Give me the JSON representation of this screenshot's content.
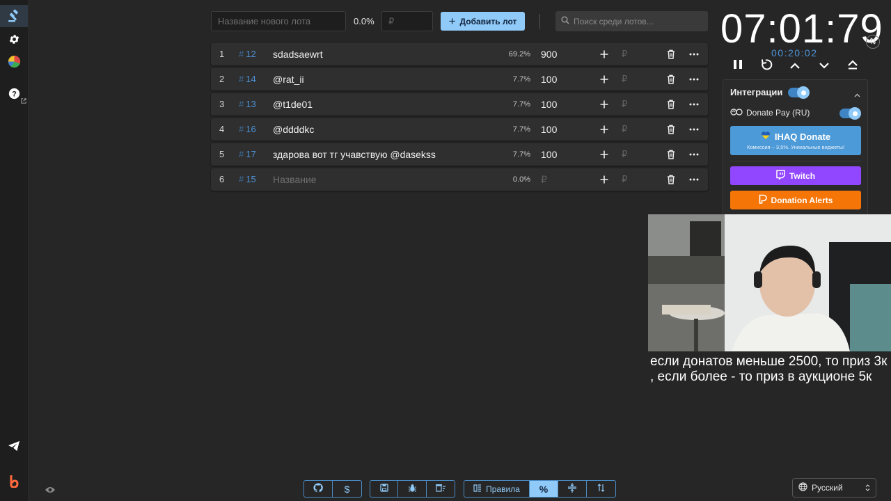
{
  "top_bar": {
    "new_lot_placeholder": "Название нового лота",
    "percent": "0.0%",
    "amount_placeholder": "₽",
    "add_button_label": "Добавить лот",
    "search_placeholder": "Поиск среди лотов..."
  },
  "lots": [
    {
      "index": "1",
      "id": "12",
      "name": "sdadsaewrt",
      "percent": "69.2%",
      "amount": "900",
      "currency": "₽"
    },
    {
      "index": "2",
      "id": "14",
      "name": "@rat_ii",
      "percent": "7.7%",
      "amount": "100",
      "currency": "₽"
    },
    {
      "index": "3",
      "id": "13",
      "name": "@t1de01",
      "percent": "7.7%",
      "amount": "100",
      "currency": "₽"
    },
    {
      "index": "4",
      "id": "16",
      "name": "@ddddkc",
      "percent": "7.7%",
      "amount": "100",
      "currency": "₽"
    },
    {
      "index": "5",
      "id": "17",
      "name": "здарова вот тг учавствую @dasekss",
      "percent": "7.7%",
      "amount": "100",
      "currency": "₽"
    },
    {
      "index": "6",
      "id": "15",
      "name_placeholder": "Название",
      "percent": "0.0%",
      "amount_placeholder": "₽",
      "currency": "₽"
    }
  ],
  "id_prefix": "#",
  "timer": {
    "main": "07:01:79",
    "secondary": "00:20:02"
  },
  "integrations": {
    "title": "Интеграции",
    "enabled": true,
    "donate_pay": {
      "label": "Donate Pay (RU)",
      "enabled": true
    },
    "ihaq": {
      "title": "IHAQ Donate",
      "subtitle": "Комиссия – 3,5%. Уникальные виджеты!"
    },
    "twitch_label": "Twitch",
    "donation_alerts_label": "Donation Alerts"
  },
  "caption": {
    "line1": "если донатов меньше 2500, то приз 3к",
    "line2": ", если более - то приз в аукционе 5к"
  },
  "bottom_toolbar": {
    "rules_label": "Правила",
    "language": "Русский"
  },
  "colors": {
    "accent": "#90caf9",
    "lot_id": "#4d94d8",
    "twitch": "#9146ff",
    "donation_alerts": "#f57507",
    "ihaq": "#4d9ad8",
    "background": "#262626"
  },
  "icons": {
    "sidebar": [
      "gavel-icon",
      "gear-icon",
      "pie-chart-icon",
      "help-icon",
      "telegram-icon",
      "bidding-logo-icon"
    ],
    "bottom_left": "eye-icon"
  }
}
